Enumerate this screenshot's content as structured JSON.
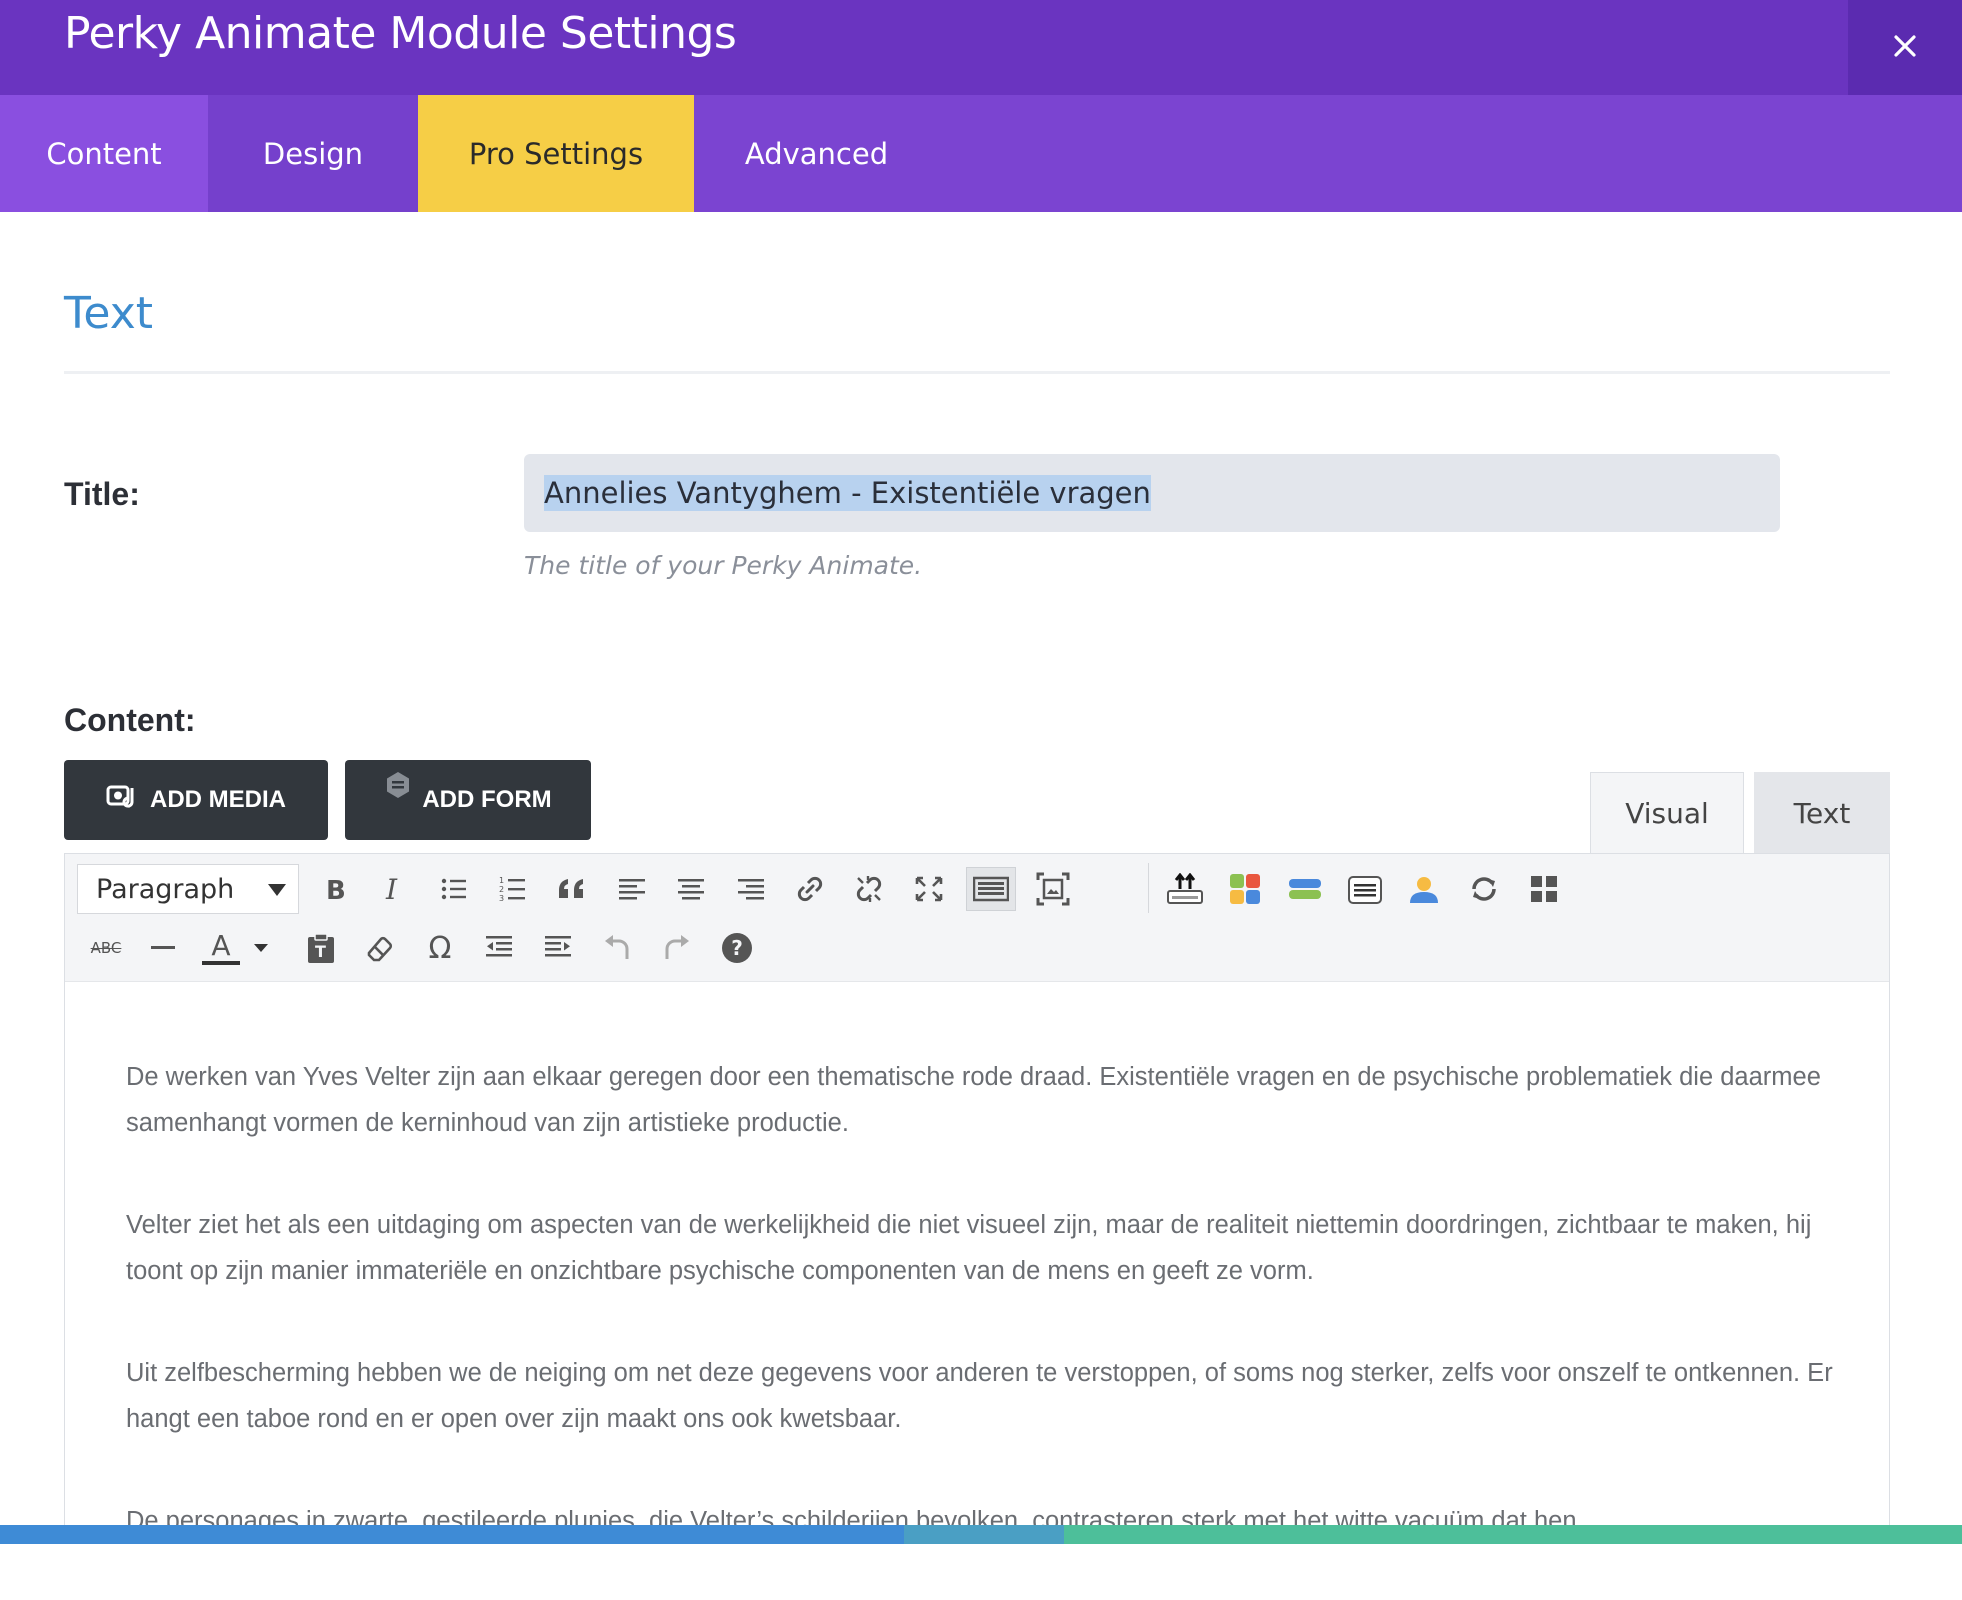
{
  "header": {
    "title": "Perky Animate Module Settings",
    "close_icon": "close-icon"
  },
  "tabs": [
    {
      "label": "Content"
    },
    {
      "label": "Design"
    },
    {
      "label": "Pro Settings"
    },
    {
      "label": "Advanced"
    }
  ],
  "section": {
    "title": "Text"
  },
  "fields": {
    "title_label": "Title:",
    "title_value": "Annelies Vantyghem - Existentiële vragen",
    "title_hint": "The title of your Perky Animate.",
    "content_label": "Content:"
  },
  "buttons": {
    "add_media": "ADD MEDIA",
    "add_form": "ADD FORM"
  },
  "editor_modes": {
    "visual": "Visual",
    "text": "Text"
  },
  "toolbar": {
    "format_select": "Paragraph",
    "strikethrough_glyph": "ABC",
    "text_color_glyph": "A",
    "special_char_glyph": "Ω",
    "help_glyph": "?"
  },
  "paragraphs": [
    "De werken van Yves Velter zijn aan elkaar geregen door een thematische rode draad. Existentiële vragen en de psychische problematiek die daarmee samenhangt vormen de kerninhoud van zijn artistieke productie.",
    "Velter ziet het als een uitdaging om aspecten van de werkelijkheid die niet visueel zijn, maar de realiteit niettemin doordringen, zichtbaar te maken, hij toont op zijn manier immateriële en onzichtbare psychische componenten van de mens  en geeft ze vorm.",
    "Uit zelfbescherming hebben we de neiging om net deze gegevens voor anderen te verstoppen, of soms nog sterker, zelfs voor onszelf te ontkennen. Er hangt een taboe rond en er open over zijn maakt ons ook kwetsbaar.",
    "De personages in zwarte, gestileerde plunjes, die Velter’s schilderijen bevolken, contrasteren sterk met het witte vacuüm dat hen"
  ],
  "colors": {
    "header_bg": "#6a34c0",
    "tabbar_bg": "#7b44d1",
    "active_tab_bg": "#f6ce46",
    "section_title": "#3d8bcd",
    "dark_button": "#32373d"
  }
}
